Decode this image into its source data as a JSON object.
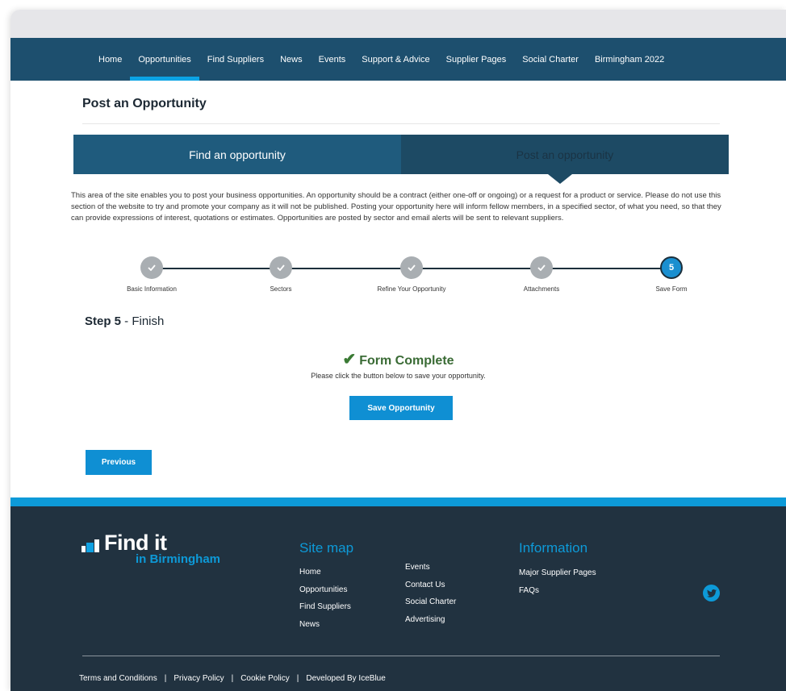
{
  "nav": {
    "items": [
      {
        "label": "Home"
      },
      {
        "label": "Opportunities",
        "active": true
      },
      {
        "label": "Find Suppliers"
      },
      {
        "label": "News"
      },
      {
        "label": "Events"
      },
      {
        "label": "Support & Advice"
      },
      {
        "label": "Supplier Pages"
      },
      {
        "label": "Social Charter"
      },
      {
        "label": "Birmingham 2022"
      }
    ]
  },
  "page": {
    "title": "Post an Opportunity"
  },
  "tabs": {
    "find": "Find an opportunity",
    "post": "Post an opportunity"
  },
  "intro": "This area of the site enables you to post your business opportunities. An opportunity should be a contract (either one-off or ongoing) or a request for a product or service. Please do not use this section of the website to try and promote your company as it will not be published. Posting your opportunity here will inform fellow members, in a specified sector, of what you need, so that they can provide expressions of interest, quotations or estimates. Opportunities are posted by sector and email alerts will be sent to relevant suppliers.",
  "stepper": {
    "steps": [
      {
        "label": "Basic Information",
        "state": "done"
      },
      {
        "label": "Sectors",
        "state": "done"
      },
      {
        "label": "Refine Your Opportunity",
        "state": "done"
      },
      {
        "label": "Attachments",
        "state": "done"
      },
      {
        "label": "Save Form",
        "state": "current",
        "number": "5"
      }
    ]
  },
  "step_heading": {
    "bold": "Step 5",
    "rest": " - Finish"
  },
  "complete": {
    "title": "Form Complete",
    "message": "Please click the button below to save your opportunity."
  },
  "buttons": {
    "save": "Save Opportunity",
    "previous": "Previous"
  },
  "footer": {
    "logo_main": "Find it",
    "logo_sub": "in Birmingham",
    "sitemap_title": "Site map",
    "sitemap_col1": [
      "Home",
      "Opportunities",
      "Find Suppliers",
      "News"
    ],
    "sitemap_col2": [
      "Events",
      "Contact Us",
      "Social Charter",
      "Advertising"
    ],
    "info_title": "Information",
    "info_links": [
      "Major Supplier Pages",
      "FAQs"
    ],
    "legal": [
      "Terms and Conditions",
      "Privacy Policy",
      "Cookie Policy",
      "Developed By IceBlue"
    ],
    "separator": "|"
  },
  "colors": {
    "nav_bg": "#1d4f6e",
    "accent": "#0d9ad8",
    "footer_bg": "#213240",
    "success": "#3a6b35"
  }
}
